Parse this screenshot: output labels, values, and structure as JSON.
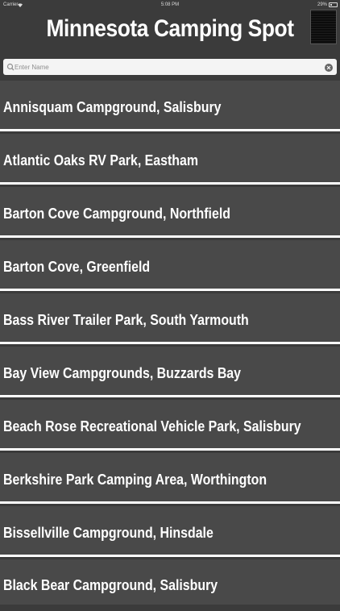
{
  "status_bar": {
    "carrier": "Carrier",
    "time": "5:08 PM",
    "battery": "29%"
  },
  "header": {
    "title": "Minnesota Camping Spot"
  },
  "search": {
    "placeholder": "Enter Name",
    "value": ""
  },
  "icons": {
    "search": "search-icon",
    "clear": "clear-icon",
    "wifi": "wifi-icon",
    "battery": "battery-icon"
  },
  "colors": {
    "background": "#3b3b3b",
    "list_item": "#494949",
    "separator": "#ffffff",
    "text": "#ffffff"
  },
  "campgrounds": [
    "Annisquam Campground, Salisbury",
    "Atlantic Oaks RV Park, Eastham",
    "Barton Cove Campground, Northfield",
    "Barton Cove, Greenfield",
    "Bass River Trailer Park, South Yarmouth",
    "Bay View Campgrounds, Buzzards Bay",
    "Beach Rose Recreational Vehicle Park, Salisbury",
    "Berkshire Park Camping Area, Worthington",
    "Bissellville Campground, Hinsdale",
    "Black Bear Campground, Salisbury"
  ]
}
